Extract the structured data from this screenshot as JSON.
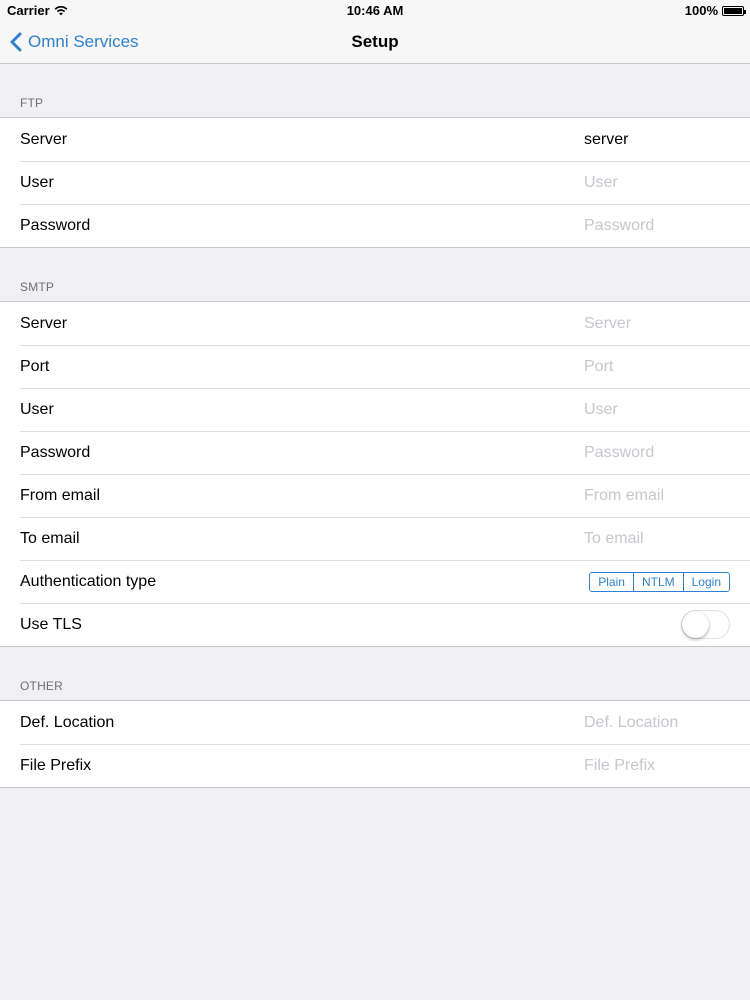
{
  "status_bar": {
    "carrier": "Carrier",
    "time": "10:46 AM",
    "battery": "100%"
  },
  "nav": {
    "back_label": "Omni Services",
    "title": "Setup"
  },
  "ftp": {
    "header": "FTP",
    "server": {
      "label": "Server",
      "value": "server",
      "placeholder": "Server"
    },
    "user": {
      "label": "User",
      "placeholder": "User"
    },
    "password": {
      "label": "Password",
      "placeholder": "Password"
    }
  },
  "smtp": {
    "header": "SMTP",
    "server": {
      "label": "Server",
      "placeholder": "Server"
    },
    "port": {
      "label": "Port",
      "placeholder": "Port"
    },
    "user": {
      "label": "User",
      "placeholder": "User"
    },
    "password": {
      "label": "Password",
      "placeholder": "Password"
    },
    "from_email": {
      "label": "From email",
      "placeholder": "From email"
    },
    "to_email": {
      "label": "To email",
      "placeholder": "To email"
    },
    "auth_type": {
      "label": "Authentication type",
      "options": [
        "Plain",
        "NTLM",
        "Login"
      ],
      "selected": ""
    },
    "use_tls": {
      "label": "Use TLS",
      "on": false
    }
  },
  "other": {
    "header": "OTHER",
    "def_location": {
      "label": "Def. Location",
      "placeholder": "Def. Location"
    },
    "file_prefix": {
      "label": "File Prefix",
      "placeholder": "File Prefix"
    }
  },
  "colors": {
    "accent": "#2f7fd3",
    "background": "#efeff4",
    "placeholder": "#c7c7cd"
  }
}
